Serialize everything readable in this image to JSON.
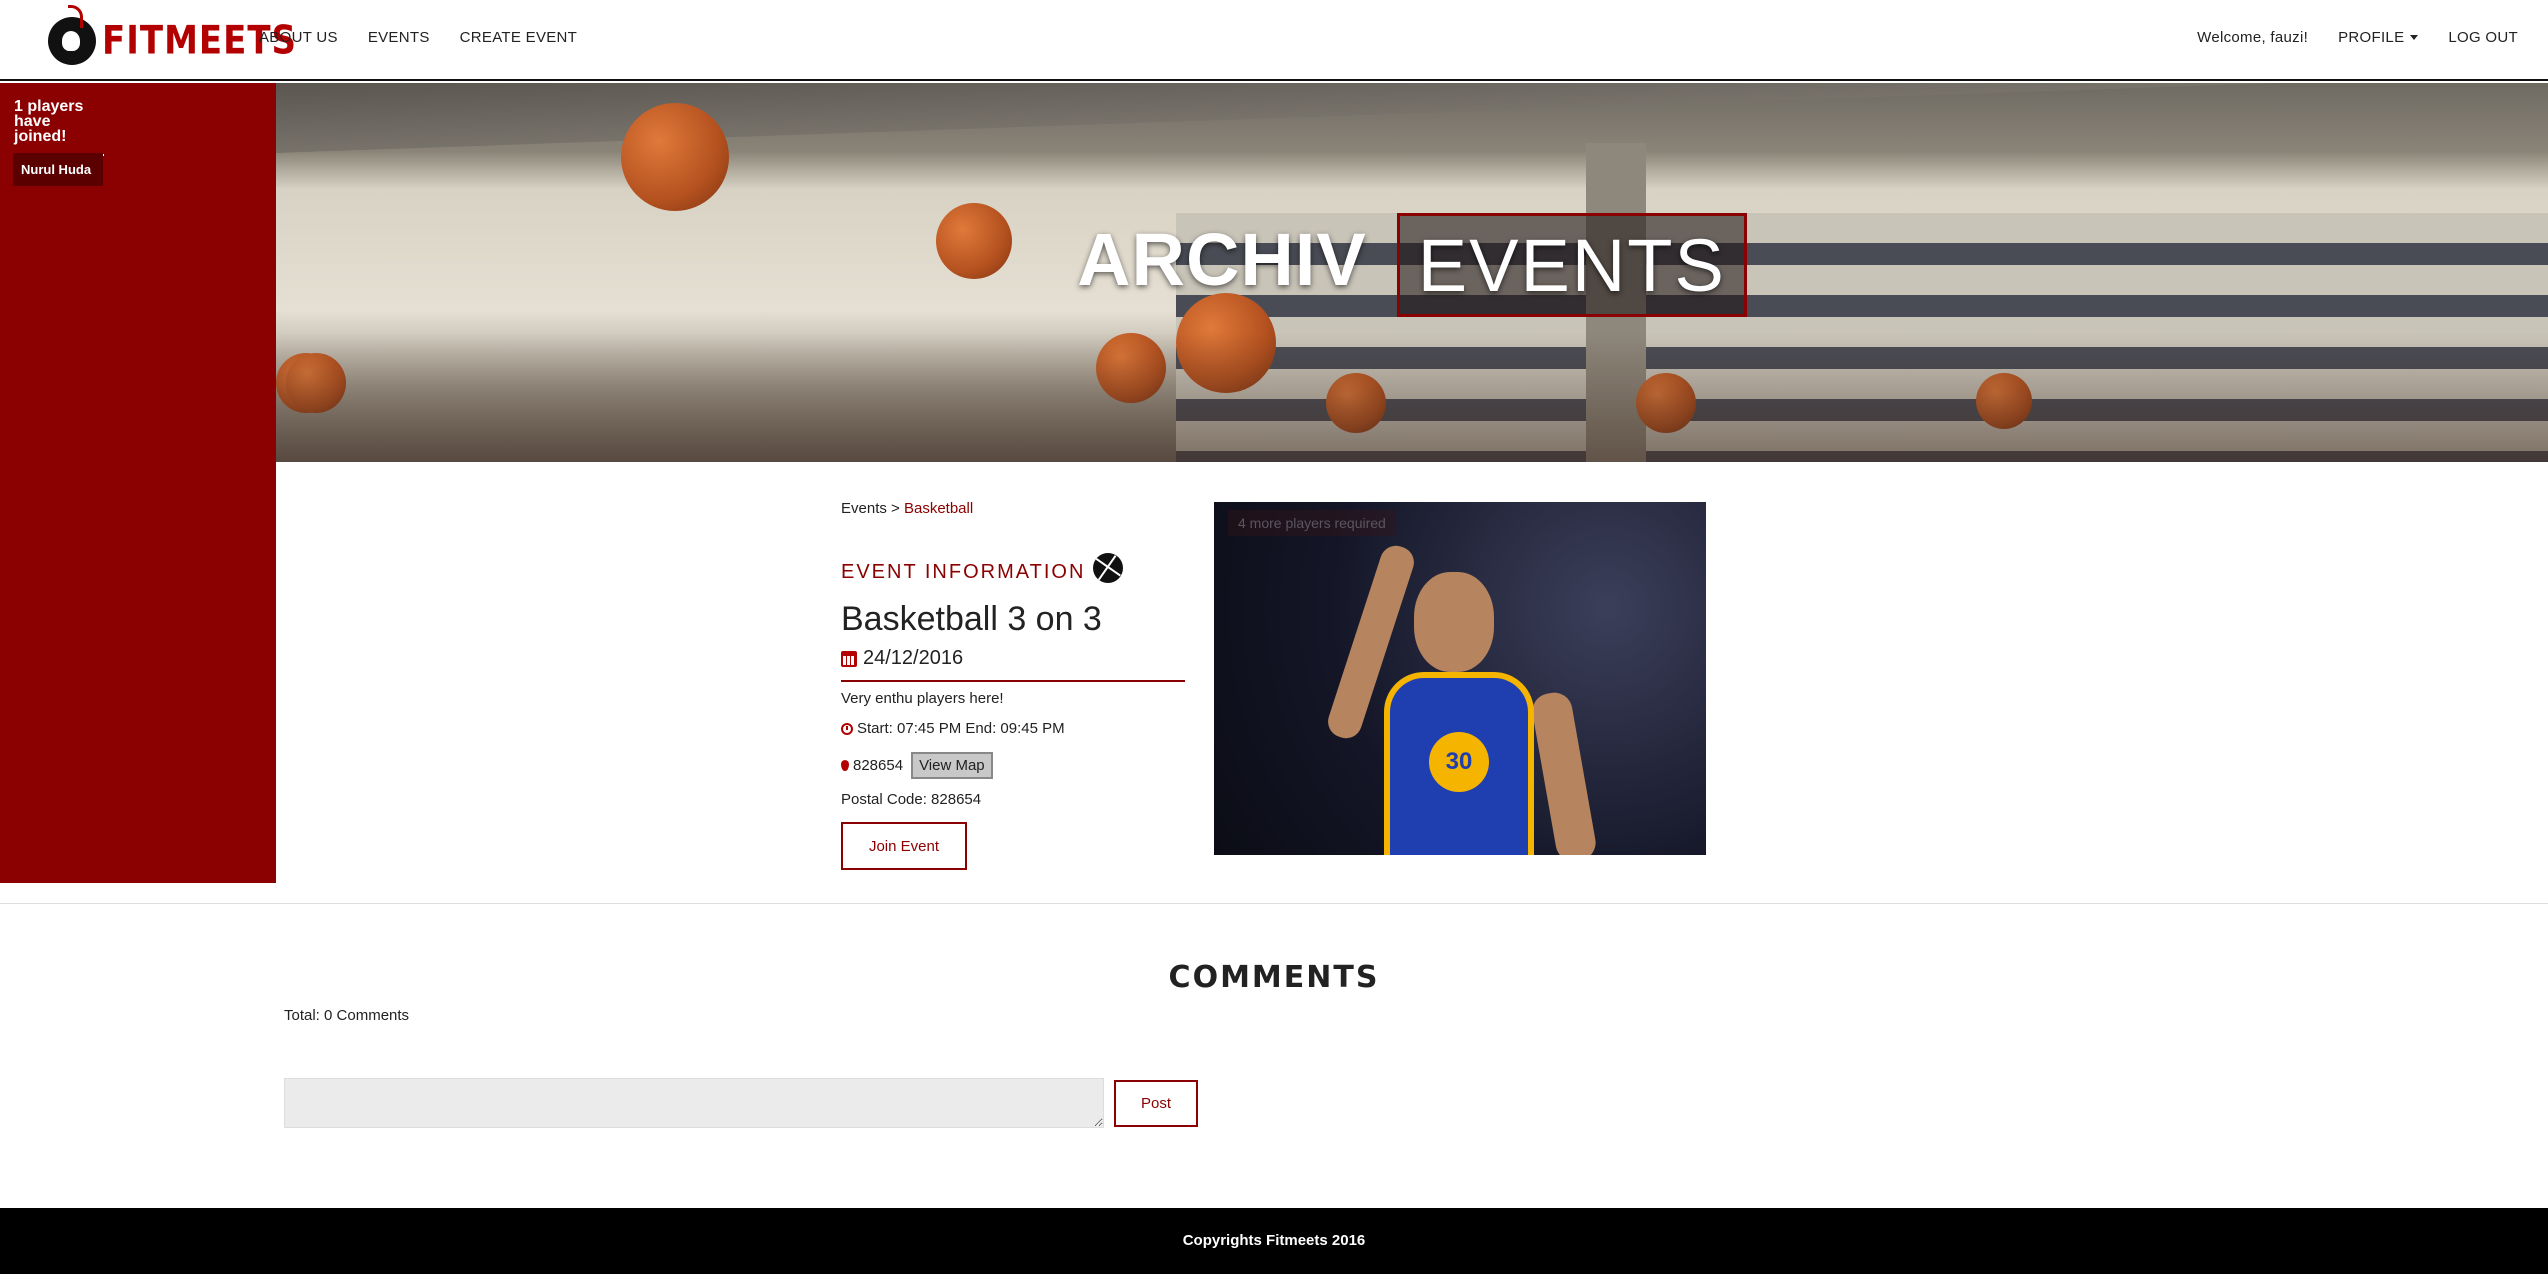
{
  "brand": {
    "name": "FITMEETS"
  },
  "nav": {
    "left": [
      "ABOUT US",
      "EVENTS",
      "CREATE EVENT"
    ],
    "welcome": "Welcome, fauzi!",
    "profile": "PROFILE",
    "logout": "LOG OUT"
  },
  "sidebar": {
    "joined_text": "1 players have joined!",
    "players": [
      "Nurul Huda"
    ]
  },
  "hero": {
    "title_first": "ARCHIV",
    "title_boxed": "EVENTS"
  },
  "breadcrumb": {
    "root": "Events",
    "separator": ">",
    "current": "Basketball"
  },
  "event": {
    "section_heading": "EVENT INFORMATION",
    "title": "Basketball 3 on 3",
    "date": "24/12/2016",
    "description": "Very enthu players here!",
    "time": "Start: 07:45 PM End: 09:45 PM",
    "location": "828654",
    "view_map": "View Map",
    "postal": "Postal Code: 828654",
    "join": "Join Event",
    "photo_badge": "4 more players required",
    "jersey_number": "30"
  },
  "comments": {
    "title": "COMMENTS",
    "total": "Total: 0 Comments",
    "placeholder": "",
    "post": "Post"
  },
  "footer": {
    "text": "Copyrights Fitmeets 2016"
  },
  "colors": {
    "accent": "#8b0000",
    "footer_bg": "#000000"
  }
}
